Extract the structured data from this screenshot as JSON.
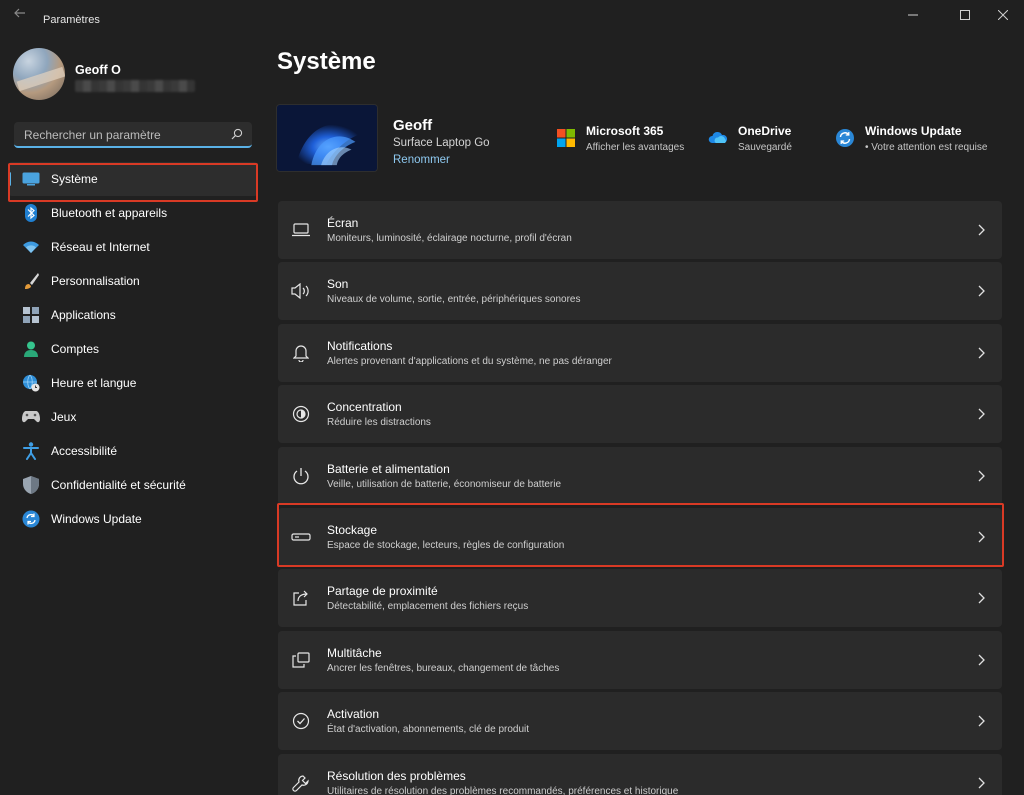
{
  "window": {
    "title": "Paramètres"
  },
  "profile": {
    "name": "Geoff O"
  },
  "search": {
    "placeholder": "Rechercher un paramètre"
  },
  "sidebar": {
    "items": [
      {
        "label": "Système",
        "icon": "system-icon",
        "active": true
      },
      {
        "label": "Bluetooth et appareils",
        "icon": "bluetooth-icon"
      },
      {
        "label": "Réseau et Internet",
        "icon": "wifi-icon"
      },
      {
        "label": "Personnalisation",
        "icon": "paintbrush-icon"
      },
      {
        "label": "Applications",
        "icon": "apps-icon"
      },
      {
        "label": "Comptes",
        "icon": "person-icon"
      },
      {
        "label": "Heure et langue",
        "icon": "globe-clock-icon"
      },
      {
        "label": "Jeux",
        "icon": "gamepad-icon"
      },
      {
        "label": "Accessibilité",
        "icon": "accessibility-icon"
      },
      {
        "label": "Confidentialité et sécurité",
        "icon": "shield-icon"
      },
      {
        "label": "Windows Update",
        "icon": "update-icon"
      }
    ]
  },
  "main": {
    "title": "Système",
    "device": {
      "name": "Geoff",
      "model": "Surface Laptop Go",
      "rename_label": "Renommer"
    },
    "quick_links": [
      {
        "title": "Microsoft 365",
        "subtitle": "Afficher les avantages",
        "icon": "microsoft-365-icon"
      },
      {
        "title": "OneDrive",
        "subtitle": "Sauvegardé",
        "icon": "onedrive-icon"
      },
      {
        "title": "Windows Update",
        "subtitle": "• Votre attention est requise",
        "icon": "windows-update-icon"
      }
    ],
    "settings": [
      {
        "title": "Écran",
        "subtitle": "Moniteurs, luminosité, éclairage nocturne, profil d'écran",
        "icon": "display-icon"
      },
      {
        "title": "Son",
        "subtitle": "Niveaux de volume, sortie, entrée, périphériques sonores",
        "icon": "speaker-icon"
      },
      {
        "title": "Notifications",
        "subtitle": "Alertes provenant d'applications et du système, ne pas déranger",
        "icon": "bell-icon"
      },
      {
        "title": "Concentration",
        "subtitle": "Réduire les distractions",
        "icon": "focus-icon"
      },
      {
        "title": "Batterie et alimentation",
        "subtitle": "Veille, utilisation de batterie, économiseur de batterie",
        "icon": "power-icon"
      },
      {
        "title": "Stockage",
        "subtitle": "Espace de stockage, lecteurs, règles de configuration",
        "icon": "storage-icon"
      },
      {
        "title": "Partage de proximité",
        "subtitle": "Détectabilité, emplacement des fichiers reçus",
        "icon": "share-icon"
      },
      {
        "title": "Multitâche",
        "subtitle": "Ancrer les fenêtres, bureaux, changement de tâches",
        "icon": "multitask-icon"
      },
      {
        "title": "Activation",
        "subtitle": "État d'activation, abonnements, clé de produit",
        "icon": "activation-icon"
      },
      {
        "title": "Résolution des problèmes",
        "subtitle": "Utilitaires de résolution des problèmes recommandés, préférences et historique",
        "icon": "wrench-icon"
      }
    ]
  },
  "colors": {
    "background": "#202020",
    "card": "#2b2b2b",
    "accent": "#5ab1e6",
    "highlight": "#d93a25"
  }
}
